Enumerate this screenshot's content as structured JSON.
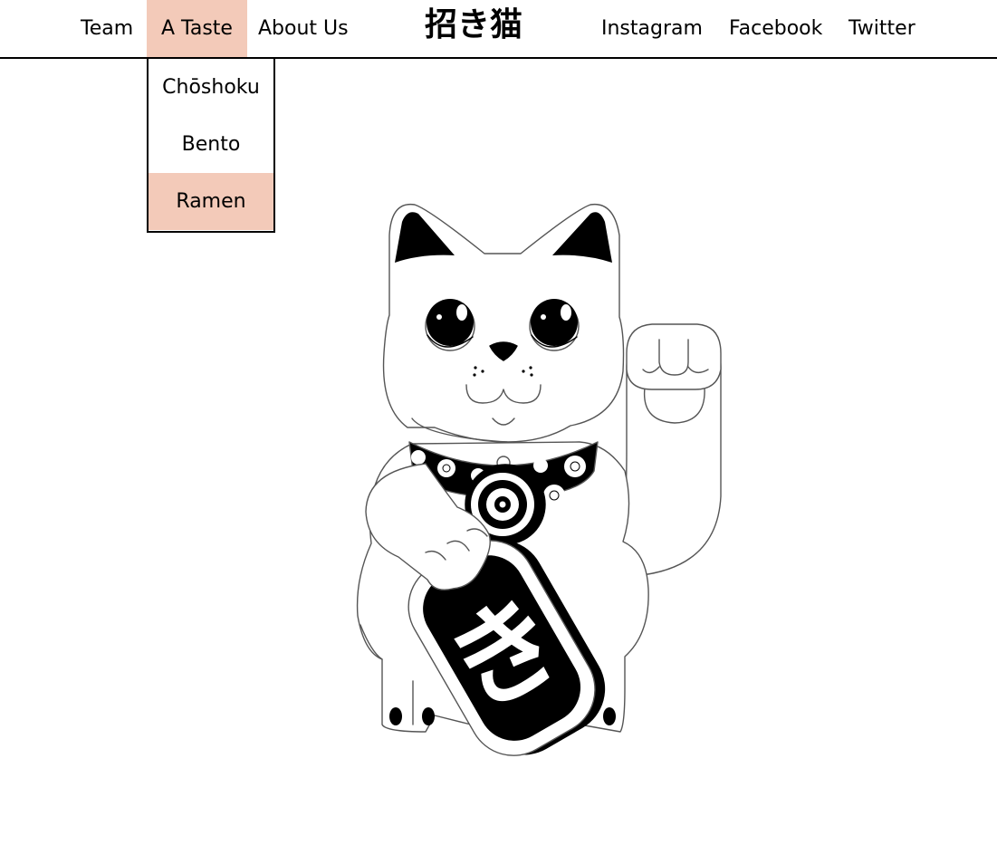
{
  "nav": {
    "items": [
      {
        "label": "Team"
      },
      {
        "label": "A Taste"
      },
      {
        "label": "About Us"
      }
    ],
    "brand": "招き猫",
    "social": [
      {
        "label": "Instagram"
      },
      {
        "label": "Facebook"
      },
      {
        "label": "Twitter"
      }
    ]
  },
  "dropdown": {
    "items": [
      {
        "label": "Chōshoku"
      },
      {
        "label": "Bento"
      },
      {
        "label": "Ramen"
      }
    ]
  },
  "illustration": {
    "coin_glyph": "き"
  },
  "colors": {
    "accent": "#f3cab9",
    "ink": "#000000",
    "background": "#ffffff"
  }
}
